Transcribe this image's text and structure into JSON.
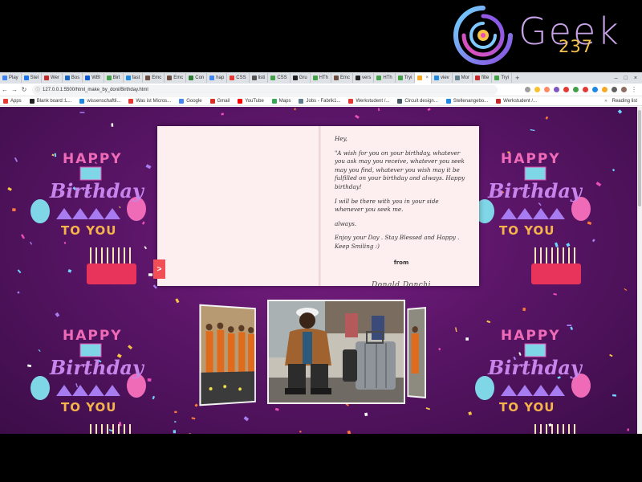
{
  "logo": {
    "text": "Geek",
    "number": "237"
  },
  "browser": {
    "tabs": [
      {
        "label": "Play",
        "color": "#4285f4"
      },
      {
        "label": "Stel",
        "color": "#1a73e8"
      },
      {
        "label": "Wer",
        "color": "#c62828"
      },
      {
        "label": "Bos",
        "color": "#1565c0"
      },
      {
        "label": "WB!",
        "color": "#0b57d0"
      },
      {
        "label": "Birt",
        "color": "#43a047"
      },
      {
        "label": "fast",
        "color": "#1e88e5"
      },
      {
        "label": "Emc",
        "color": "#6d4c41"
      },
      {
        "label": "Emc",
        "color": "#6d4c41"
      },
      {
        "label": "Con",
        "color": "#2e7d32"
      },
      {
        "label": "hap",
        "color": "#4285f4"
      },
      {
        "label": "CSS",
        "color": "#e53935"
      },
      {
        "label": "listi",
        "color": "#555555"
      },
      {
        "label": "CSS",
        "color": "#43a047"
      },
      {
        "label": "Gru",
        "color": "#212121"
      },
      {
        "label": "HTh",
        "color": "#43a047"
      },
      {
        "label": "Emc",
        "color": "#6d4c41"
      },
      {
        "label": "vers",
        "color": "#212121"
      },
      {
        "label": "HTh",
        "color": "#43a047"
      },
      {
        "label": "Tryi",
        "color": "#43a047"
      },
      {
        "label": "",
        "color": "#f9a825",
        "active": true
      },
      {
        "label": "viev",
        "color": "#1e88e5"
      },
      {
        "label": "Mor",
        "color": "#607d8b"
      },
      {
        "label": "filte",
        "color": "#c62828"
      },
      {
        "label": "Tryi",
        "color": "#43a047"
      }
    ],
    "new_tab_label": "+",
    "address": "127.0.0.1:5500/html_make_by_doni/Birthday.html",
    "bookmarks": [
      {
        "label": "Apps",
        "color": "#e53935"
      },
      {
        "label": "Blank board::L...",
        "color": "#212121"
      },
      {
        "label": "wissenschaftli...",
        "color": "#1e88e5"
      },
      {
        "label": "Was ist Micros...",
        "color": "#e53935"
      },
      {
        "label": "Google",
        "color": "#4285f4"
      },
      {
        "label": "Gmail",
        "color": "#d93025"
      },
      {
        "label": "YouTube",
        "color": "#ff0000"
      },
      {
        "label": "Maps",
        "color": "#34a853"
      },
      {
        "label": "Jobs - Fabrik1...",
        "color": "#607d8b"
      },
      {
        "label": "Werkstudent /...",
        "color": "#e53935"
      },
      {
        "label": "Circuit design...",
        "color": "#455a64"
      },
      {
        "label": "Stellenangebo...",
        "color": "#1e88e5"
      },
      {
        "label": "Werkstudent /...",
        "color": "#c62828"
      }
    ],
    "reading_list": "Reading list"
  },
  "banner": {
    "happy": "HAPPY",
    "birthday": "Birthday",
    "to_you": "TO YOU"
  },
  "card": {
    "greeting": "Hey,",
    "paragraph1": "\"A wish for you on your birthday, whatever you ask may you receive, whatever you seek may you find, whatever you wish may it be fulfilled on your birthday and always. Happy birthday!",
    "paragraph2": "I will be there with you in your side whenever you seek me.",
    "paragraph3": "always.",
    "paragraph4": "Enjoy your Day . Stay Blessed and Happy . Keep Smiling :)",
    "from": "from",
    "signature": "Donald Donchi"
  },
  "next_button": ">"
}
